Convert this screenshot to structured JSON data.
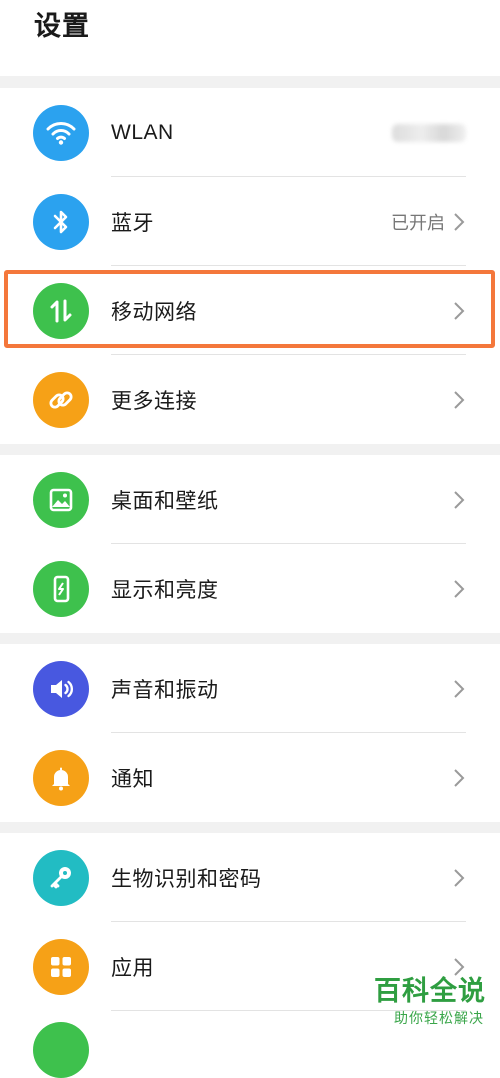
{
  "header": {
    "title": "设置"
  },
  "groups": [
    [
      {
        "label": "WLAN",
        "value": "",
        "value_blurred": true,
        "icon": "wifi-icon",
        "color": "#2ba2ef"
      },
      {
        "label": "蓝牙",
        "value": "已开启",
        "icon": "bluetooth-icon",
        "color": "#2ba2ef"
      },
      {
        "label": "移动网络",
        "value": "",
        "icon": "mobile-data-icon",
        "color": "#3ec14d",
        "highlighted": true
      },
      {
        "label": "更多连接",
        "value": "",
        "icon": "link-icon",
        "color": "#f6a117"
      }
    ],
    [
      {
        "label": "桌面和壁纸",
        "value": "",
        "icon": "wallpaper-icon",
        "color": "#3ec14d"
      },
      {
        "label": "显示和亮度",
        "value": "",
        "icon": "display-icon",
        "color": "#3ec14d"
      }
    ],
    [
      {
        "label": "声音和振动",
        "value": "",
        "icon": "volume-icon",
        "color": "#4858e0"
      },
      {
        "label": "通知",
        "value": "",
        "icon": "bell-icon",
        "color": "#f6a117"
      }
    ],
    [
      {
        "label": "生物识别和密码",
        "value": "",
        "icon": "key-icon",
        "color": "#22bcc3"
      },
      {
        "label": "应用",
        "value": "",
        "icon": "apps-icon",
        "color": "#f6a117"
      }
    ]
  ],
  "watermark": {
    "title": "百科全说",
    "subtitle": "助你轻松解决"
  },
  "colors": {
    "highlight_border": "#f4773b",
    "watermark_green": "#2f9e41"
  }
}
